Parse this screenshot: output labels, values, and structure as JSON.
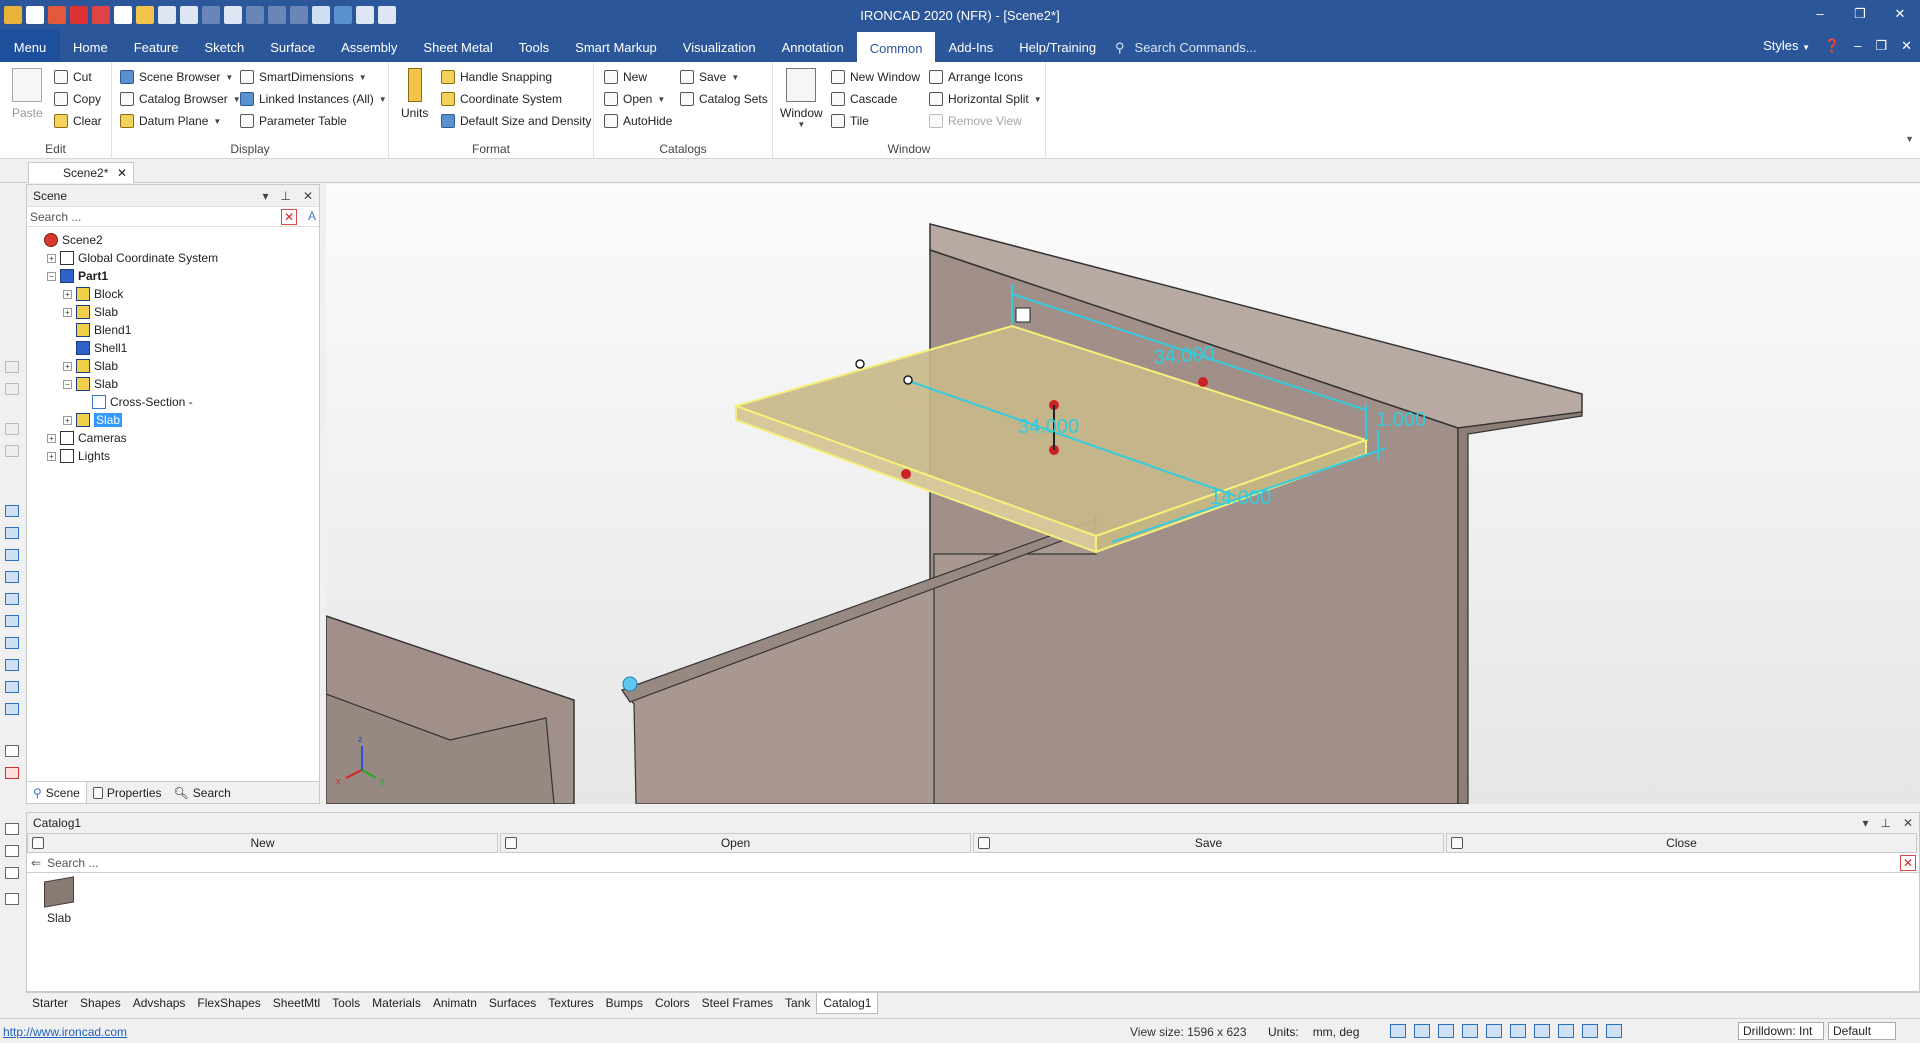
{
  "window": {
    "title": "IRONCAD 2020 (NFR) - [Scene2*]",
    "controls": [
      "–",
      "❐",
      "✕"
    ]
  },
  "menubar": {
    "tabs": [
      "Menu",
      "Home",
      "Feature",
      "Sketch",
      "Surface",
      "Assembly",
      "Sheet Metal",
      "Tools",
      "Smart Markup",
      "Visualization",
      "Annotation",
      "Common",
      "Add-Ins",
      "Help/Training"
    ],
    "active_tab": "Common",
    "search_placeholder": "Search Commands...",
    "styles_label": "Styles"
  },
  "ribbon": {
    "edit": {
      "label": "Edit",
      "paste": "Paste",
      "cut": "Cut",
      "copy": "Copy",
      "clear": "Clear"
    },
    "display": {
      "label": "Display",
      "scene_browser": "Scene Browser",
      "catalog_browser": "Catalog Browser",
      "datum_plane": "Datum Plane",
      "smart_dimensions": "SmartDimensions",
      "linked_instances": "Linked Instances (All)",
      "parameter_table": "Parameter Table"
    },
    "format": {
      "label": "Format",
      "units": "Units",
      "handle_snapping": "Handle Snapping",
      "coordinate_system": "Coordinate System",
      "default_size": "Default Size and Density"
    },
    "catalogs": {
      "label": "Catalogs",
      "new": "New",
      "open": "Open",
      "autohide": "AutoHide",
      "save": "Save",
      "catalog_sets": "Catalog Sets"
    },
    "window": {
      "label": "Window",
      "window": "Window",
      "new_window": "New Window",
      "cascade": "Cascade",
      "tile": "Tile",
      "arrange_icons": "Arrange Icons",
      "horizontal_split": "Horizontal Split",
      "remove_view": "Remove View"
    }
  },
  "document_tab": "Scene2*",
  "scene_panel": {
    "title": "Scene",
    "search_placeholder": "Search ...",
    "tree": [
      {
        "label": "Scene2",
        "depth": 0,
        "icon": "scene",
        "expander": ""
      },
      {
        "label": "Global Coordinate System",
        "depth": 1,
        "icon": "sys",
        "expander": "+"
      },
      {
        "label": "Part1",
        "depth": 1,
        "icon": "part",
        "expander": "−",
        "bold": true
      },
      {
        "label": "Block",
        "depth": 2,
        "icon": "shape",
        "expander": "+"
      },
      {
        "label": "Slab",
        "depth": 2,
        "icon": "shape",
        "expander": "+"
      },
      {
        "label": "Blend1",
        "depth": 2,
        "icon": "shape",
        "expander": ""
      },
      {
        "label": "Shell1",
        "depth": 2,
        "icon": "part",
        "expander": ""
      },
      {
        "label": "Slab",
        "depth": 2,
        "icon": "shape",
        "expander": "+"
      },
      {
        "label": "Slab",
        "depth": 2,
        "icon": "shape",
        "expander": "−"
      },
      {
        "label": "Cross-Section -",
        "depth": 3,
        "icon": "cs",
        "expander": ""
      },
      {
        "label": "Slab",
        "depth": 2,
        "icon": "shape",
        "expander": "+",
        "selected": true
      },
      {
        "label": "Cameras",
        "depth": 1,
        "icon": "sys",
        "expander": "+"
      },
      {
        "label": "Lights",
        "depth": 1,
        "icon": "sys",
        "expander": "+"
      }
    ],
    "bottom_tabs": [
      "Scene",
      "Properties",
      "Search"
    ]
  },
  "viewport": {
    "dimensions": [
      "34.000",
      "34.000",
      "1.000",
      "14.000"
    ],
    "triad": {
      "x": "x",
      "y": "y",
      "z": "z"
    },
    "colors": {
      "body": "#a09089",
      "body_dark": "#8c7d76",
      "slab": "#c8b98a",
      "highlight": "#f4f07a",
      "dim": "#33ccdd"
    }
  },
  "catalog_panel": {
    "title": "Catalog1",
    "buttons": [
      "New",
      "Open",
      "Save",
      "Close"
    ],
    "search_placeholder": "Search ...",
    "items": [
      {
        "label": "Slab"
      }
    ]
  },
  "catalog_tabs": [
    "Starter",
    "Shapes",
    "Advshaps",
    "FlexShapes",
    "SheetMtl",
    "Tools",
    "Materials",
    "Animatn",
    "Surfaces",
    "Textures",
    "Bumps",
    "Colors",
    "Steel Frames",
    "Tank",
    "Catalog1"
  ],
  "catalog_active_tab": "Catalog1",
  "status": {
    "url": "http://www.ironcad.com",
    "view_size": "View size: 1596 x  623",
    "units_label": "Units:",
    "units_value": "mm, deg",
    "drilldown": "Drilldown: Int",
    "default": "Default"
  }
}
